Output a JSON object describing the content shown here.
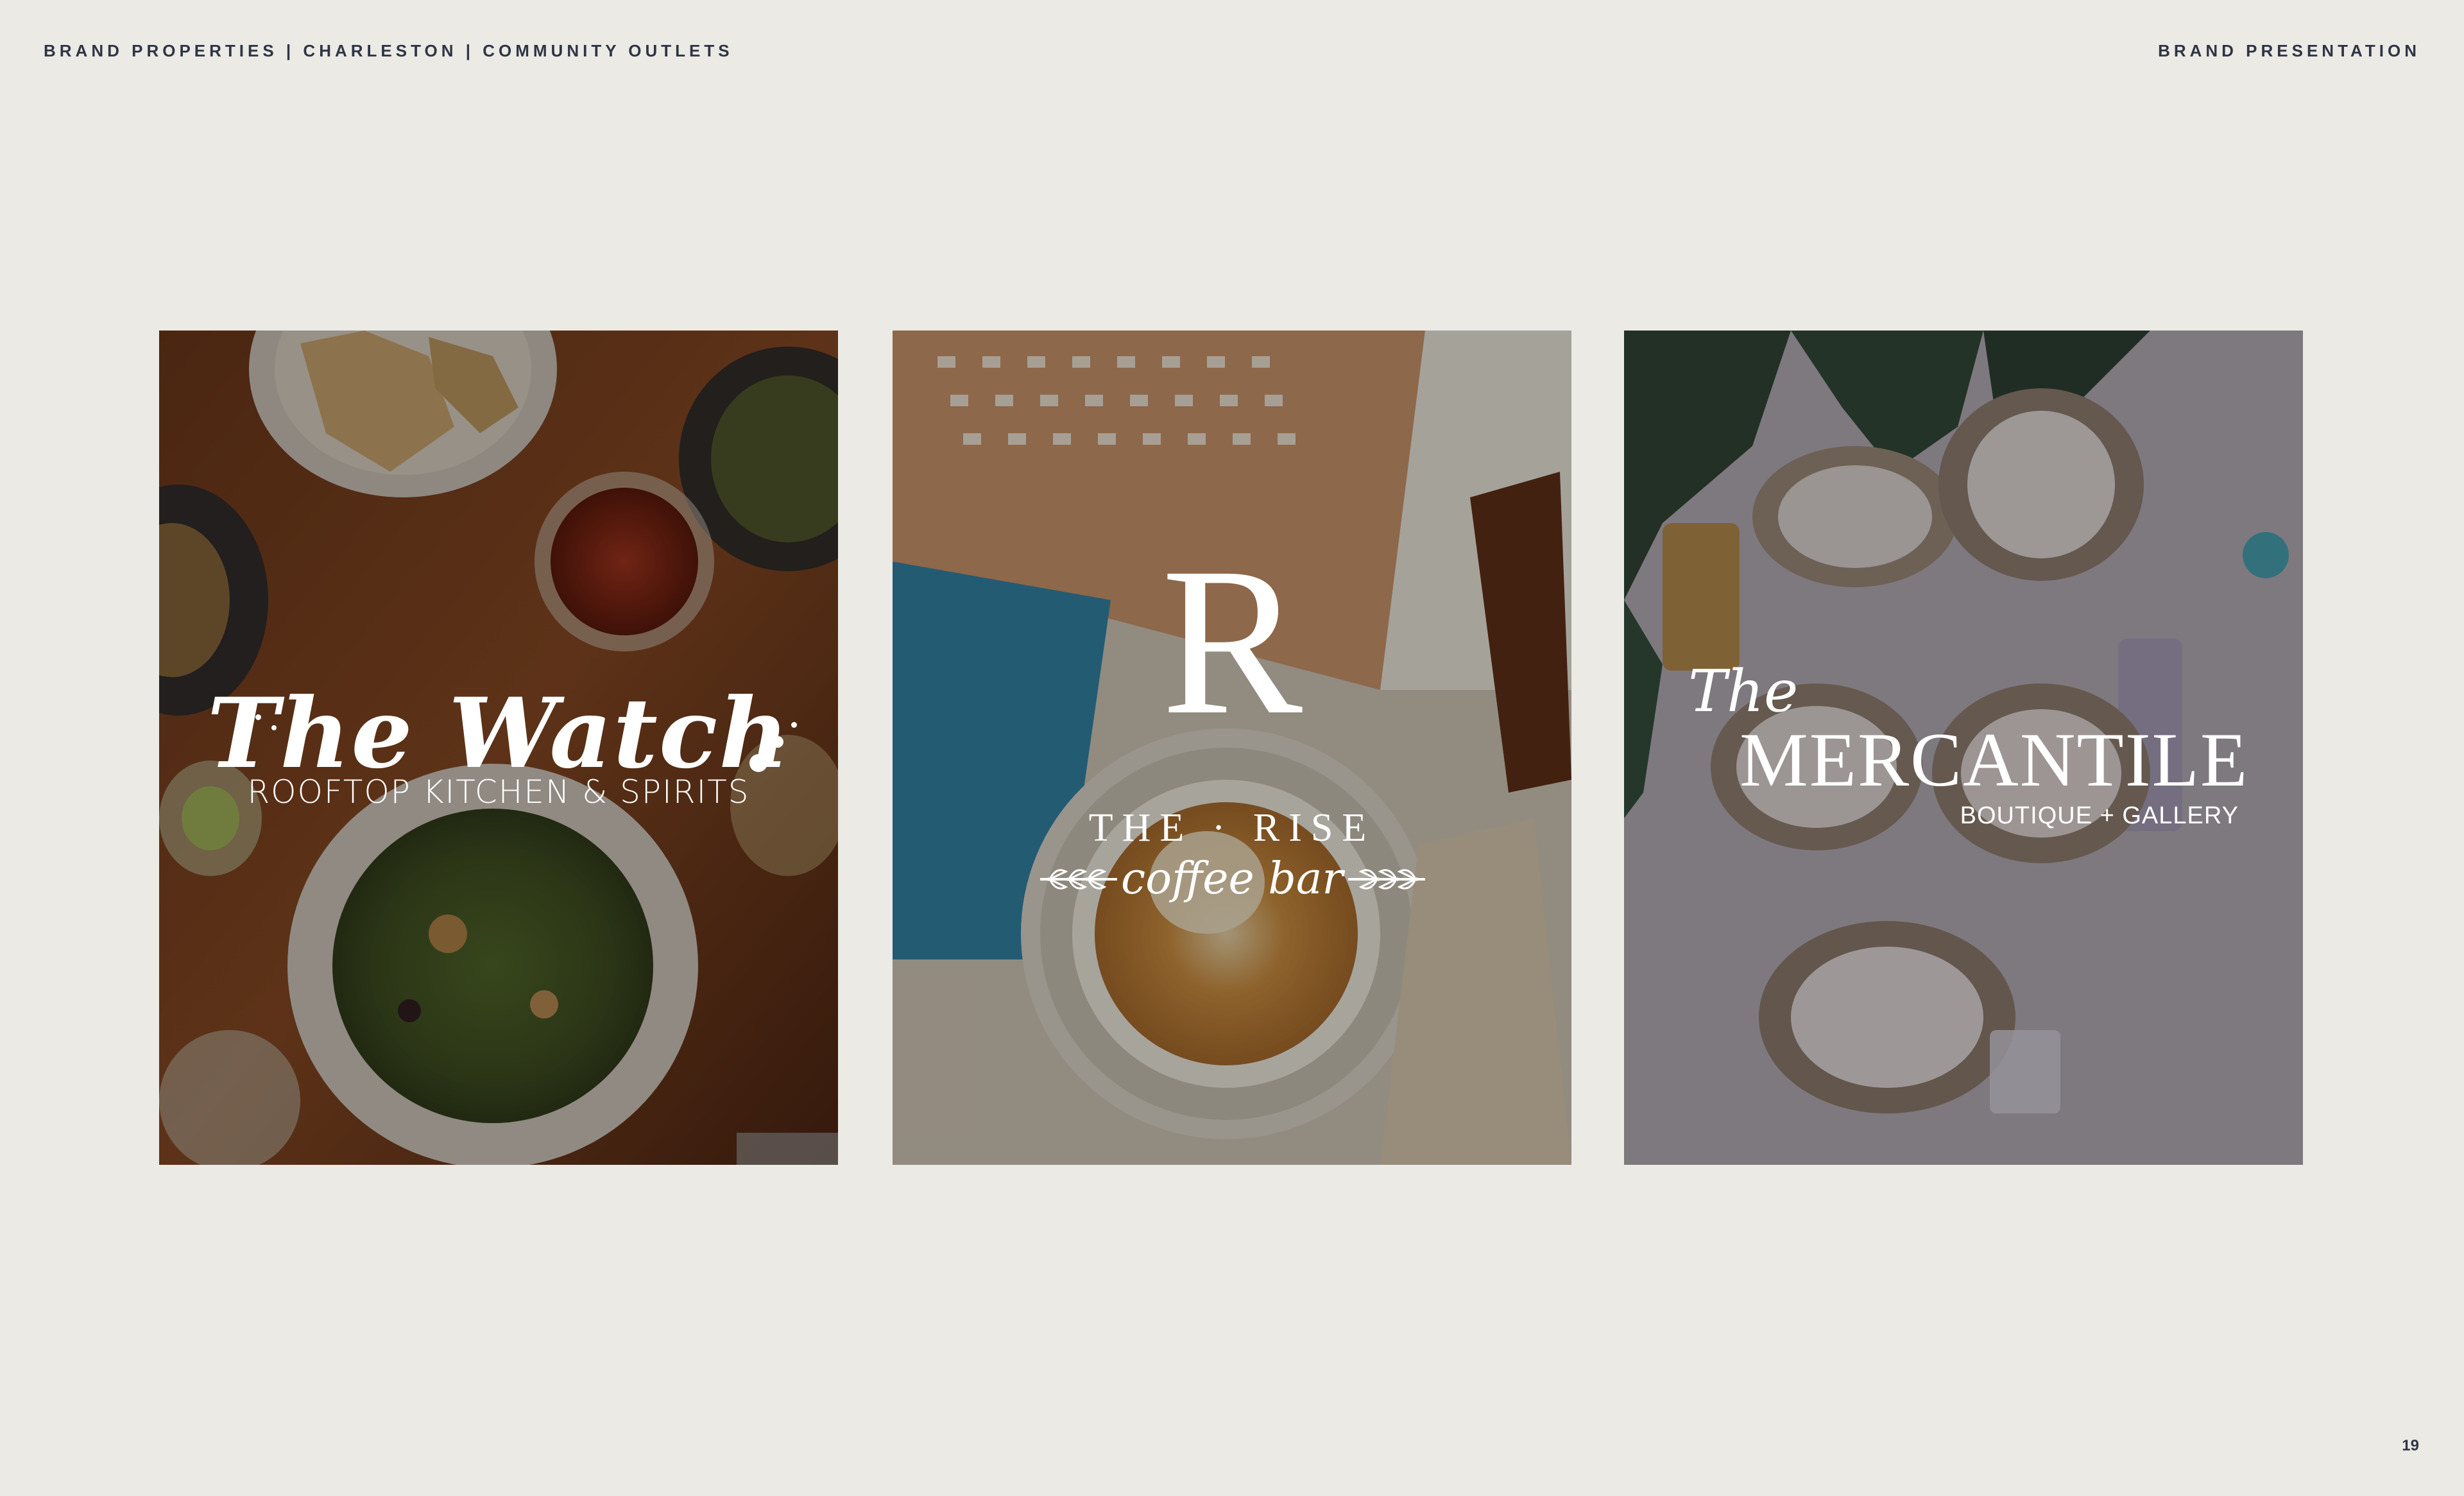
{
  "header": {
    "left": "BRAND PROPERTIES | CHARLESTON | COMMUNITY OUTLETS",
    "right": "BRAND PRESENTATION"
  },
  "page_number": "19",
  "panels": [
    {
      "title": "The Watch",
      "subtitle": "ROOFTOP KITCHEN & SPIRITS"
    },
    {
      "monogram": "R",
      "title": "THE · RISE",
      "subtitle": "coffee bar"
    },
    {
      "title_prefix": "The",
      "title": "MERCANTILE",
      "subtitle": "BOUTIQUE + GALLERY"
    }
  ],
  "colors": {
    "background": "#ebeae5",
    "header_text": "#2f3545",
    "logo_text": "#ffffff"
  }
}
